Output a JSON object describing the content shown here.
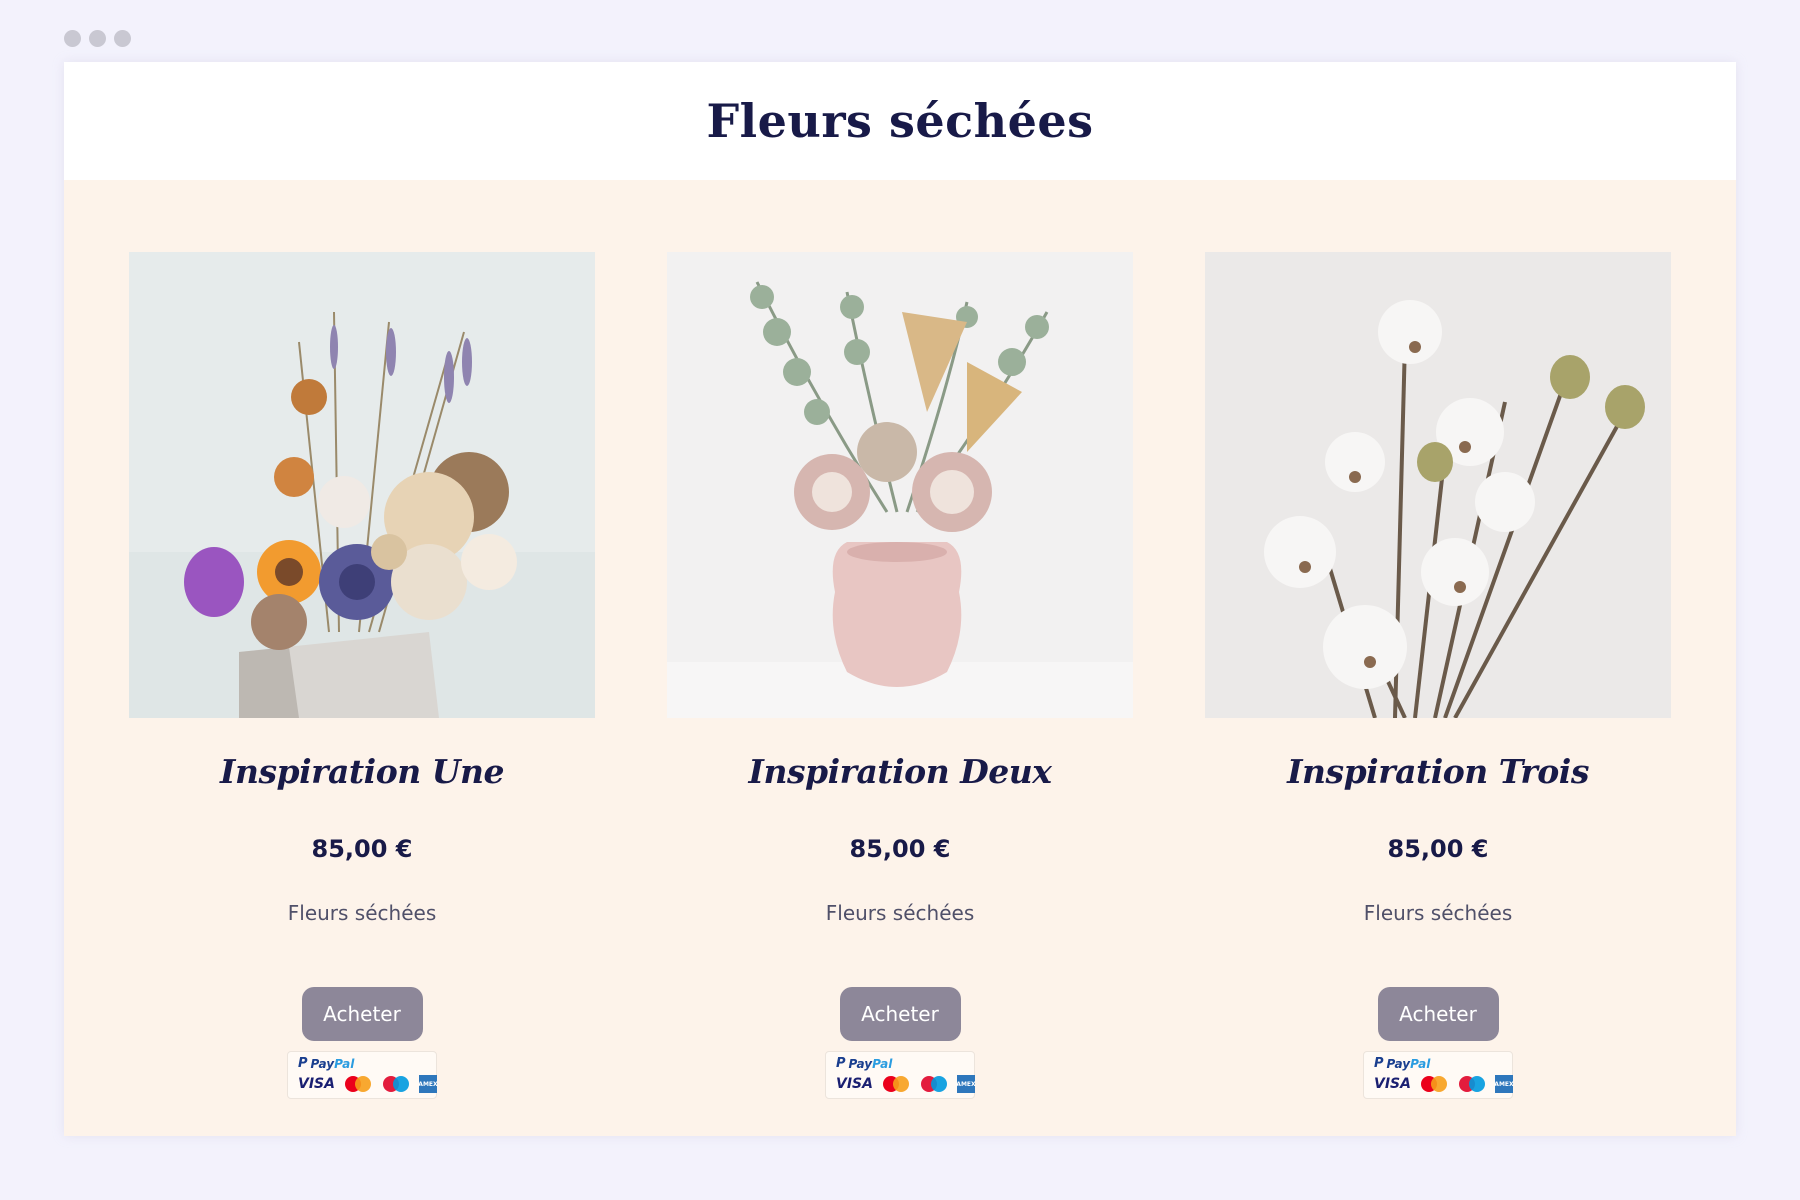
{
  "window": {
    "title": "Fleurs séchées"
  },
  "colors": {
    "accent": "#181a48",
    "background": "#fdf3ea",
    "button": "#8d8799"
  },
  "products": [
    {
      "name": "Inspiration Une",
      "price": "85,00 €",
      "category": "Fleurs séchées",
      "button_label": "Acheter",
      "payment": {
        "paypal_p": "P",
        "paypal_a": "Pay",
        "paypal_b": "Pal",
        "visa": "VISA",
        "amex": "AMEX"
      }
    },
    {
      "name": "Inspiration Deux",
      "price": "85,00 €",
      "category": "Fleurs séchées",
      "button_label": "Acheter",
      "payment": {
        "paypal_p": "P",
        "paypal_a": "Pay",
        "paypal_b": "Pal",
        "visa": "VISA",
        "amex": "AMEX"
      }
    },
    {
      "name": "Inspiration Trois",
      "price": "85,00 €",
      "category": "Fleurs séchées",
      "button_label": "Acheter",
      "payment": {
        "paypal_p": "P",
        "paypal_a": "Pay",
        "paypal_b": "Pal",
        "visa": "VISA",
        "amex": "AMEX"
      }
    }
  ]
}
